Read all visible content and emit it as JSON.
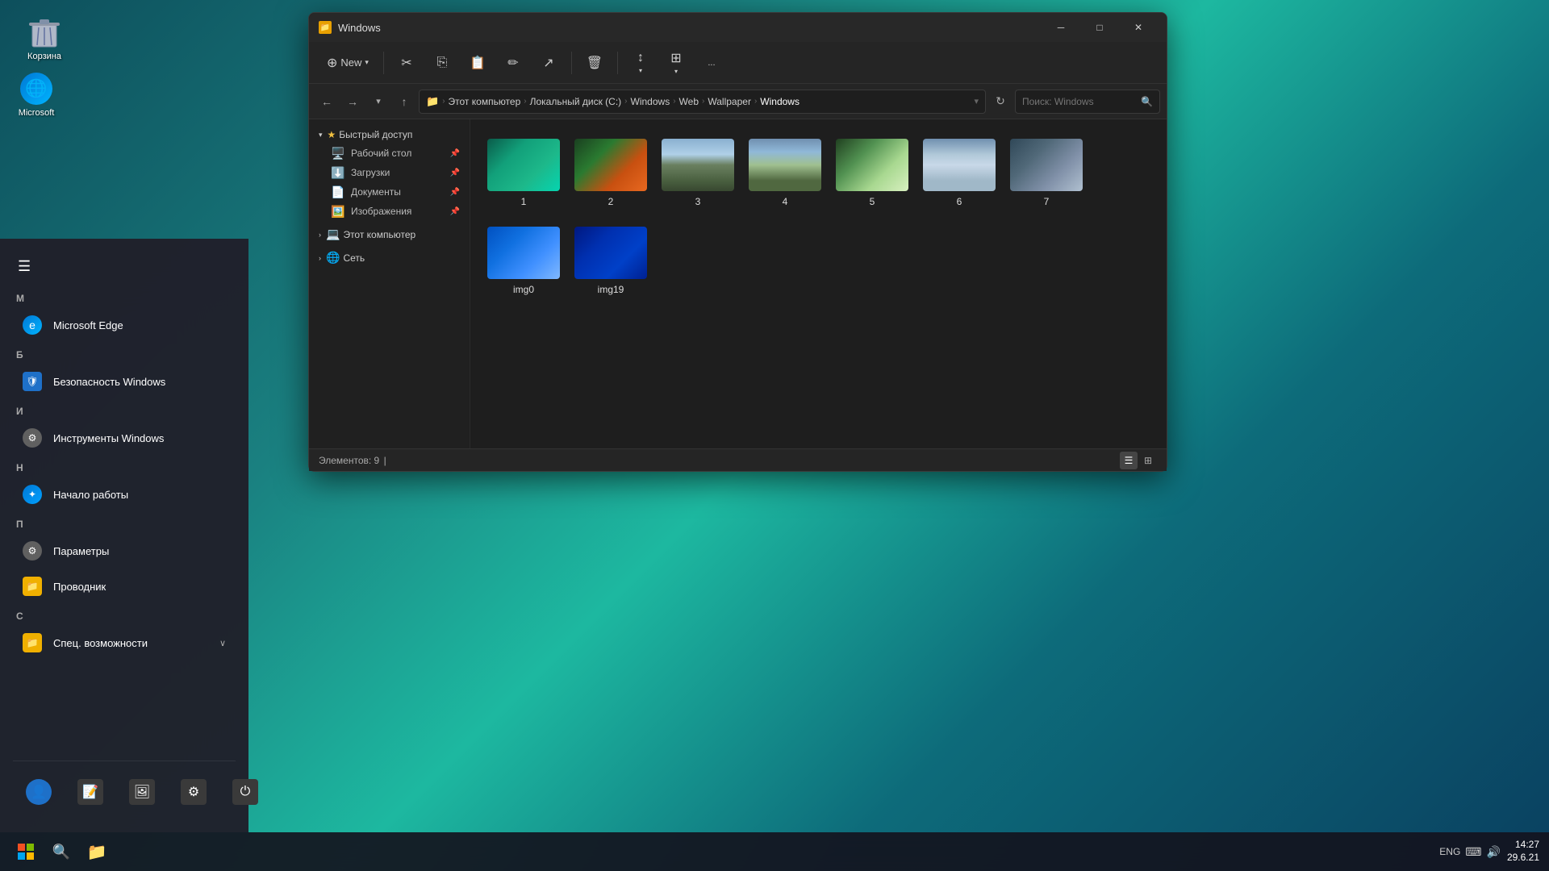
{
  "desktop": {
    "background": "linear-gradient teal"
  },
  "desktop_icons": [
    {
      "id": "recycle-bin",
      "label": "Корзина",
      "icon": "🗑️"
    }
  ],
  "taskbar": {
    "start_tooltip": "Пуск",
    "search_tooltip": "Поиск",
    "explorer_tooltip": "Проводник",
    "lang": "ENG",
    "time": "14:27",
    "date": "29.6.21"
  },
  "start_menu": {
    "categories": [
      {
        "id": "M",
        "label": "М"
      },
      {
        "id": "B",
        "label": "Б"
      },
      {
        "id": "I",
        "label": "И"
      },
      {
        "id": "N",
        "label": "Н"
      },
      {
        "id": "P",
        "label": "П"
      },
      {
        "id": "S",
        "label": "С"
      }
    ],
    "items": [
      {
        "id": "microsoft-edge",
        "label": "Microsoft Edge",
        "category": "М",
        "icon": "edge"
      },
      {
        "id": "windows-security",
        "label": "Безопасность Windows",
        "category": "Б",
        "icon": "security"
      },
      {
        "id": "windows-tools",
        "label": "Инструменты Windows",
        "category": "И",
        "icon": "tools"
      },
      {
        "id": "get-started",
        "label": "Начало работы",
        "category": "Н",
        "icon": "start"
      },
      {
        "id": "settings",
        "label": "Параметры",
        "category": "П",
        "icon": "settings"
      },
      {
        "id": "explorer",
        "label": "Проводник",
        "category": "П",
        "icon": "explorer"
      },
      {
        "id": "special",
        "label": "Спец. возможности",
        "category": "С",
        "icon": "special"
      }
    ],
    "bottom_items": [
      {
        "id": "user",
        "label": "Пользователь",
        "icon": "user"
      },
      {
        "id": "notes",
        "label": "Заметки",
        "icon": "notes"
      },
      {
        "id": "gallery",
        "label": "Галерея",
        "icon": "gallery"
      },
      {
        "id": "settings2",
        "label": "Настройки",
        "icon": "gear"
      },
      {
        "id": "power",
        "label": "Питание",
        "icon": "power"
      }
    ]
  },
  "file_explorer": {
    "title": "Windows",
    "toolbar": {
      "new_label": "New",
      "cut_icon": "✂",
      "copy_icon": "⎘",
      "paste_icon": "📋",
      "rename_icon": "✏",
      "share_icon": "↗",
      "delete_icon": "🗑",
      "sort_label": "",
      "view_label": "",
      "more_label": "..."
    },
    "breadcrumb": {
      "parts": [
        "Этот компьютер",
        "Локальный диск (C:)",
        "Windows",
        "Web",
        "Wallpaper",
        "Windows"
      ],
      "separator": "›"
    },
    "search_placeholder": "Поиск: Windows",
    "sidebar": {
      "quick_access_label": "Быстрый доступ",
      "items": [
        {
          "id": "desktop",
          "label": "Рабочий стол",
          "icon": "🖥️",
          "pinned": true
        },
        {
          "id": "downloads",
          "label": "Загрузки",
          "icon": "⬇️",
          "pinned": true
        },
        {
          "id": "documents",
          "label": "Документы",
          "icon": "📄",
          "pinned": true
        },
        {
          "id": "pictures",
          "label": "Изображения",
          "icon": "🖼️",
          "pinned": true
        }
      ],
      "this_pc_label": "Этот компьютер",
      "network_label": "Сеть"
    },
    "files": [
      {
        "id": "file-1",
        "name": "1",
        "thumb": "thumb-1"
      },
      {
        "id": "file-2",
        "name": "2",
        "thumb": "thumb-2"
      },
      {
        "id": "file-3",
        "name": "3",
        "thumb": "thumb-3"
      },
      {
        "id": "file-4",
        "name": "4",
        "thumb": "thumb-4"
      },
      {
        "id": "file-5",
        "name": "5",
        "thumb": "thumb-5"
      },
      {
        "id": "file-6",
        "name": "6",
        "thumb": "thumb-6"
      },
      {
        "id": "file-7",
        "name": "7",
        "thumb": "thumb-7"
      },
      {
        "id": "file-img0",
        "name": "img0",
        "thumb": "thumb-img0"
      },
      {
        "id": "file-img19",
        "name": "img19",
        "thumb": "thumb-img19"
      }
    ],
    "status": {
      "items_count": "Элементов: 9",
      "cursor": "|"
    }
  }
}
